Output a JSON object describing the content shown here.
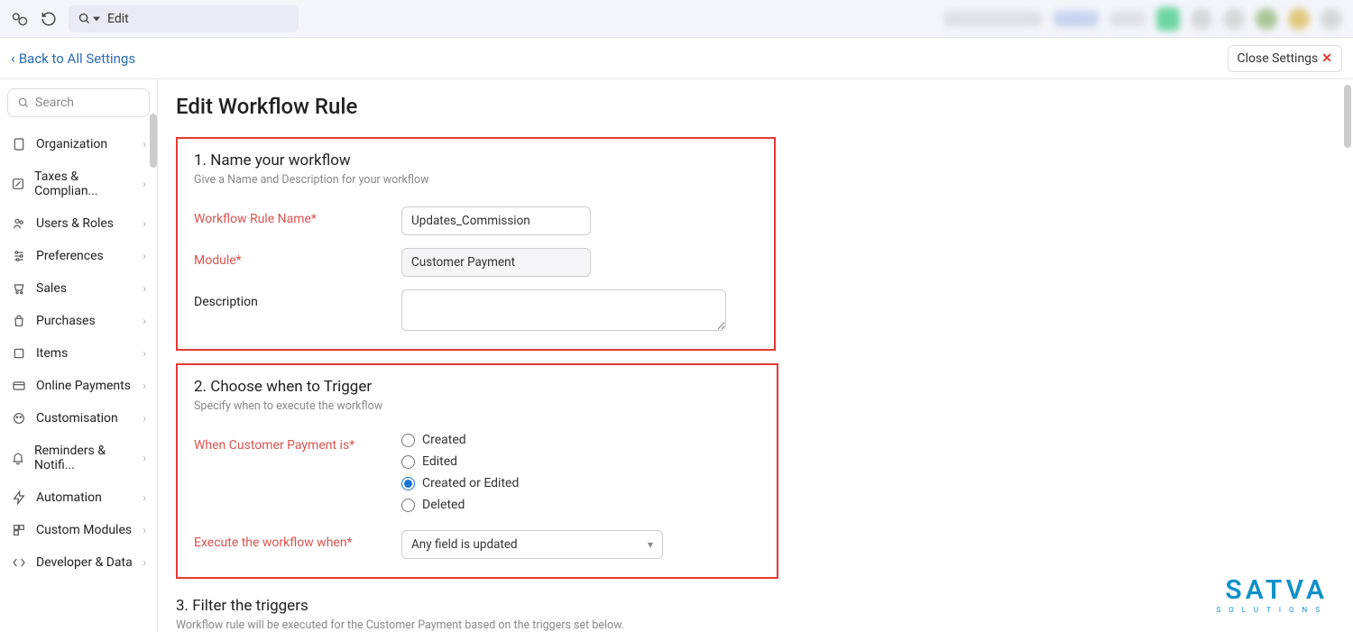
{
  "topbar": {
    "search_value": "Edit"
  },
  "subbar": {
    "back_label": "Back to All Settings",
    "close_label": "Close Settings"
  },
  "sidebar": {
    "search_placeholder": "Search",
    "items": [
      {
        "label": "Organization"
      },
      {
        "label": "Taxes & Complian..."
      },
      {
        "label": "Users & Roles"
      },
      {
        "label": "Preferences"
      },
      {
        "label": "Sales"
      },
      {
        "label": "Purchases"
      },
      {
        "label": "Items"
      },
      {
        "label": "Online Payments"
      },
      {
        "label": "Customisation"
      },
      {
        "label": "Reminders & Notifi..."
      },
      {
        "label": "Automation"
      },
      {
        "label": "Custom Modules"
      },
      {
        "label": "Developer & Data"
      }
    ]
  },
  "page": {
    "title": "Edit Workflow Rule"
  },
  "section1": {
    "title": "1. Name your workflow",
    "subtitle": "Give a Name and Description for your workflow",
    "name_label": "Workflow Rule Name*",
    "name_value": "Updates_Commission",
    "module_label": "Module*",
    "module_value": "Customer Payment",
    "desc_label": "Description",
    "desc_value": ""
  },
  "section2": {
    "title": "2. Choose when to Trigger",
    "subtitle": "Specify when to execute the workflow",
    "when_label": "When Customer Payment is*",
    "options": {
      "created": "Created",
      "edited": "Edited",
      "created_or_edited": "Created or Edited",
      "deleted": "Deleted"
    },
    "selected": "created_or_edited",
    "exec_label": "Execute the workflow when*",
    "exec_value": "Any field is updated"
  },
  "section3": {
    "title": "3. Filter the triggers",
    "subtitle": "Workflow rule will be executed for the Customer Payment based on the triggers set below."
  },
  "watermark": {
    "big": "SATVA",
    "small": "SOLUTIONS"
  }
}
